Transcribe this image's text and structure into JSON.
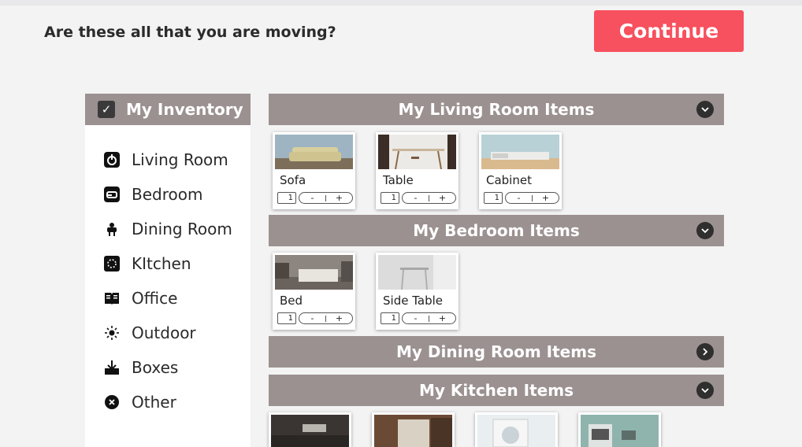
{
  "header": {
    "question": "Are these all that you are moving?",
    "continue_label": "Continue"
  },
  "sidebar": {
    "title": "My Inventory",
    "items": [
      {
        "label": "Living Room",
        "icon": "power-icon"
      },
      {
        "label": "Bedroom",
        "icon": "bed-icon"
      },
      {
        "label": "Dining Room",
        "icon": "dining-icon"
      },
      {
        "label": "KItchen",
        "icon": "kitchen-icon"
      },
      {
        "label": "Office",
        "icon": "book-icon"
      },
      {
        "label": "Outdoor",
        "icon": "sun-icon"
      },
      {
        "label": "Boxes",
        "icon": "box-icon"
      },
      {
        "label": "Other",
        "icon": "close-circle-icon"
      }
    ]
  },
  "sections": {
    "living": {
      "title": "My Living Room Items",
      "items": [
        {
          "name": "Sofa",
          "qty": "1"
        },
        {
          "name": "Table",
          "qty": "1"
        },
        {
          "name": "Cabinet",
          "qty": "1"
        }
      ]
    },
    "bedroom": {
      "title": "My Bedroom Items",
      "items": [
        {
          "name": "Bed",
          "qty": "1"
        },
        {
          "name": "Side Table",
          "qty": "1"
        }
      ]
    },
    "dining": {
      "title": "My Dining Room Items"
    },
    "kitchen": {
      "title": "My Kitchen Items"
    }
  },
  "stepper": {
    "minus": "-",
    "plus": "+"
  },
  "colors": {
    "accent": "#f7505e",
    "bar": "#9b9190",
    "background": "#f3f3f3"
  }
}
